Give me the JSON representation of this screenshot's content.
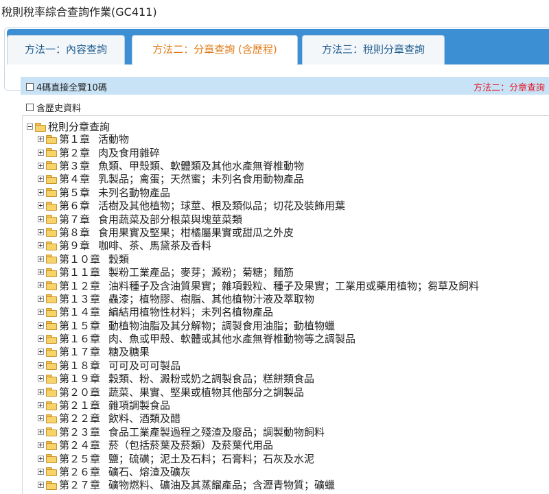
{
  "page": {
    "title": "稅則稅率綜合查詢作業(GC411)"
  },
  "tabs": [
    {
      "label": "方法一：內容查詢",
      "active": false
    },
    {
      "label": "方法二：分章查詢 (含歷程)",
      "active": true
    },
    {
      "label": "方法三：稅則分章查詢",
      "active": false
    }
  ],
  "strip": {
    "checkbox_label": "4碼直接全覽10碼",
    "method_label": "方法二：分章查詢"
  },
  "history": {
    "checkbox_label": "含歷史資料"
  },
  "tree": {
    "root_label": "稅則分章查詢",
    "chapters": [
      {
        "num": "第１章",
        "name": "活動物"
      },
      {
        "num": "第２章",
        "name": "肉及食用雜碎"
      },
      {
        "num": "第３章",
        "name": "魚類、甲殼類、軟體類及其他水產無脊椎動物"
      },
      {
        "num": "第４章",
        "name": "乳製品；禽蛋；天然蜜；未列名食用動物產品"
      },
      {
        "num": "第５章",
        "name": "未列名動物產品"
      },
      {
        "num": "第６章",
        "name": "活樹及其他植物；球莖、根及類似品；切花及裝飾用葉"
      },
      {
        "num": "第７章",
        "name": "食用蔬菜及部分根菜與塊莖菜類"
      },
      {
        "num": "第８章",
        "name": "食用果實及堅果；柑橘屬果實或甜瓜之外皮"
      },
      {
        "num": "第９章",
        "name": "咖啡、茶、馬黛茶及香料"
      },
      {
        "num": "第１０章",
        "name": "穀類"
      },
      {
        "num": "第１１章",
        "name": "製粉工業產品；麥芽；澱粉；菊糖；麵筋"
      },
      {
        "num": "第１２章",
        "name": "油料種子及含油質果實；雜項穀粒、種子及果實；工業用或藥用植物；芻草及飼料"
      },
      {
        "num": "第１３章",
        "name": "蟲漆；植物膠、樹脂、其他植物汁液及萃取物"
      },
      {
        "num": "第１４章",
        "name": "編結用植物性材料；未列名植物產品"
      },
      {
        "num": "第１５章",
        "name": "動植物油脂及其分解物；調製食用油脂；動植物蠟"
      },
      {
        "num": "第１６章",
        "name": "肉、魚或甲殼、軟體或其他水產無脊椎動物等之調製品"
      },
      {
        "num": "第１７章",
        "name": "糖及糖果"
      },
      {
        "num": "第１８章",
        "name": "可可及可可製品"
      },
      {
        "num": "第１９章",
        "name": "穀類、粉、澱粉或奶之調製食品；糕餅類食品"
      },
      {
        "num": "第２０章",
        "name": "蔬菜、果實、堅果或植物其他部分之調製品"
      },
      {
        "num": "第２１章",
        "name": "雜項調製食品"
      },
      {
        "num": "第２２章",
        "name": "飲料、酒類及醋"
      },
      {
        "num": "第２３章",
        "name": "食品工業產製過程之殘渣及廢品；調製動物飼料"
      },
      {
        "num": "第２４章",
        "name": "菸（包括菸葉及菸類）及菸葉代用品"
      },
      {
        "num": "第２５章",
        "name": "鹽；硫磺；泥土及石料；石膏料；石灰及水泥"
      },
      {
        "num": "第２６章",
        "name": "礦石、熔渣及礦灰"
      },
      {
        "num": "第２７章",
        "name": "礦物燃料、礦油及其蒸餾產品；含瀝青物質；礦蠟"
      }
    ]
  }
}
